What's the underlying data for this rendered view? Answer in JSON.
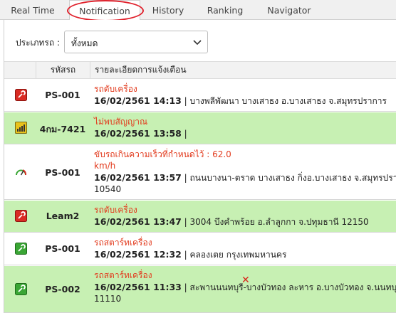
{
  "tabs": [
    {
      "label": "Real Time"
    },
    {
      "label": "Notification"
    },
    {
      "label": "History"
    },
    {
      "label": "Ranking"
    },
    {
      "label": "Navigator"
    }
  ],
  "filter": {
    "label": "ประเภทรถ :",
    "value": "ทั้งหมด"
  },
  "table": {
    "col_code": "รหัสรถ",
    "col_detail": "รายละเอียดการแจ้งเตือน"
  },
  "rows": [
    {
      "code": "PS-001",
      "icon": "engine-off-icon",
      "title": "รถดับเครื่อง",
      "title2": "",
      "datetime": "16/02/2561 14:13",
      "location": " | บางพลีพัฒนา บางเสาธง อ.บางเสาธง จ.สมุทรปราการ",
      "location2": ""
    },
    {
      "code": "4กม-7421",
      "icon": "no-signal-icon",
      "title": "ไม่พบสัญญาณ",
      "title2": "",
      "datetime": "16/02/2561 13:58",
      "location": " |",
      "location2": ""
    },
    {
      "code": "PS-001",
      "icon": "speedometer-icon",
      "title": "ขับรถเกินความเร็วที่กำหนดไว้ : 62.0",
      "title2": "km/h",
      "datetime": "16/02/2561 13:57",
      "location": " | ถนนบางนา-ตราด บางเสาธง กิ่งอ.บางเสาธง จ.สมุทรปราการ",
      "location2": "10540"
    },
    {
      "code": "Leam2",
      "icon": "engine-off-icon",
      "title": "รถดับเครื่อง",
      "title2": "",
      "datetime": "16/02/2561 13:47",
      "location": " | 3004 บึงคำพร้อย อ.ลำลูกกา จ.ปทุมธานี 12150",
      "location2": ""
    },
    {
      "code": "PS-001",
      "icon": "engine-start-icon",
      "title": "รถสตาร์ทเครื่อง",
      "title2": "",
      "datetime": "16/02/2561 12:32",
      "location": " | คลองเตย กรุงเทพมหานคร",
      "location2": ""
    },
    {
      "code": "PS-002",
      "icon": "engine-start-icon",
      "title": "รถสตาร์ทเครื่อง",
      "title2": "",
      "datetime": "16/02/2561 11:33",
      "location": " | สะพานนนทบุรี-บางบัวทอง ละหาร อ.บางบัวทอง จ.นนทบุรี",
      "location2": "11110"
    }
  ],
  "colors": {
    "green_row": "#c7f0b3",
    "alert_text": "#e23b1e",
    "icon_red": "#d92b23",
    "icon_green": "#3aa635",
    "highlight": "#e0202b"
  }
}
